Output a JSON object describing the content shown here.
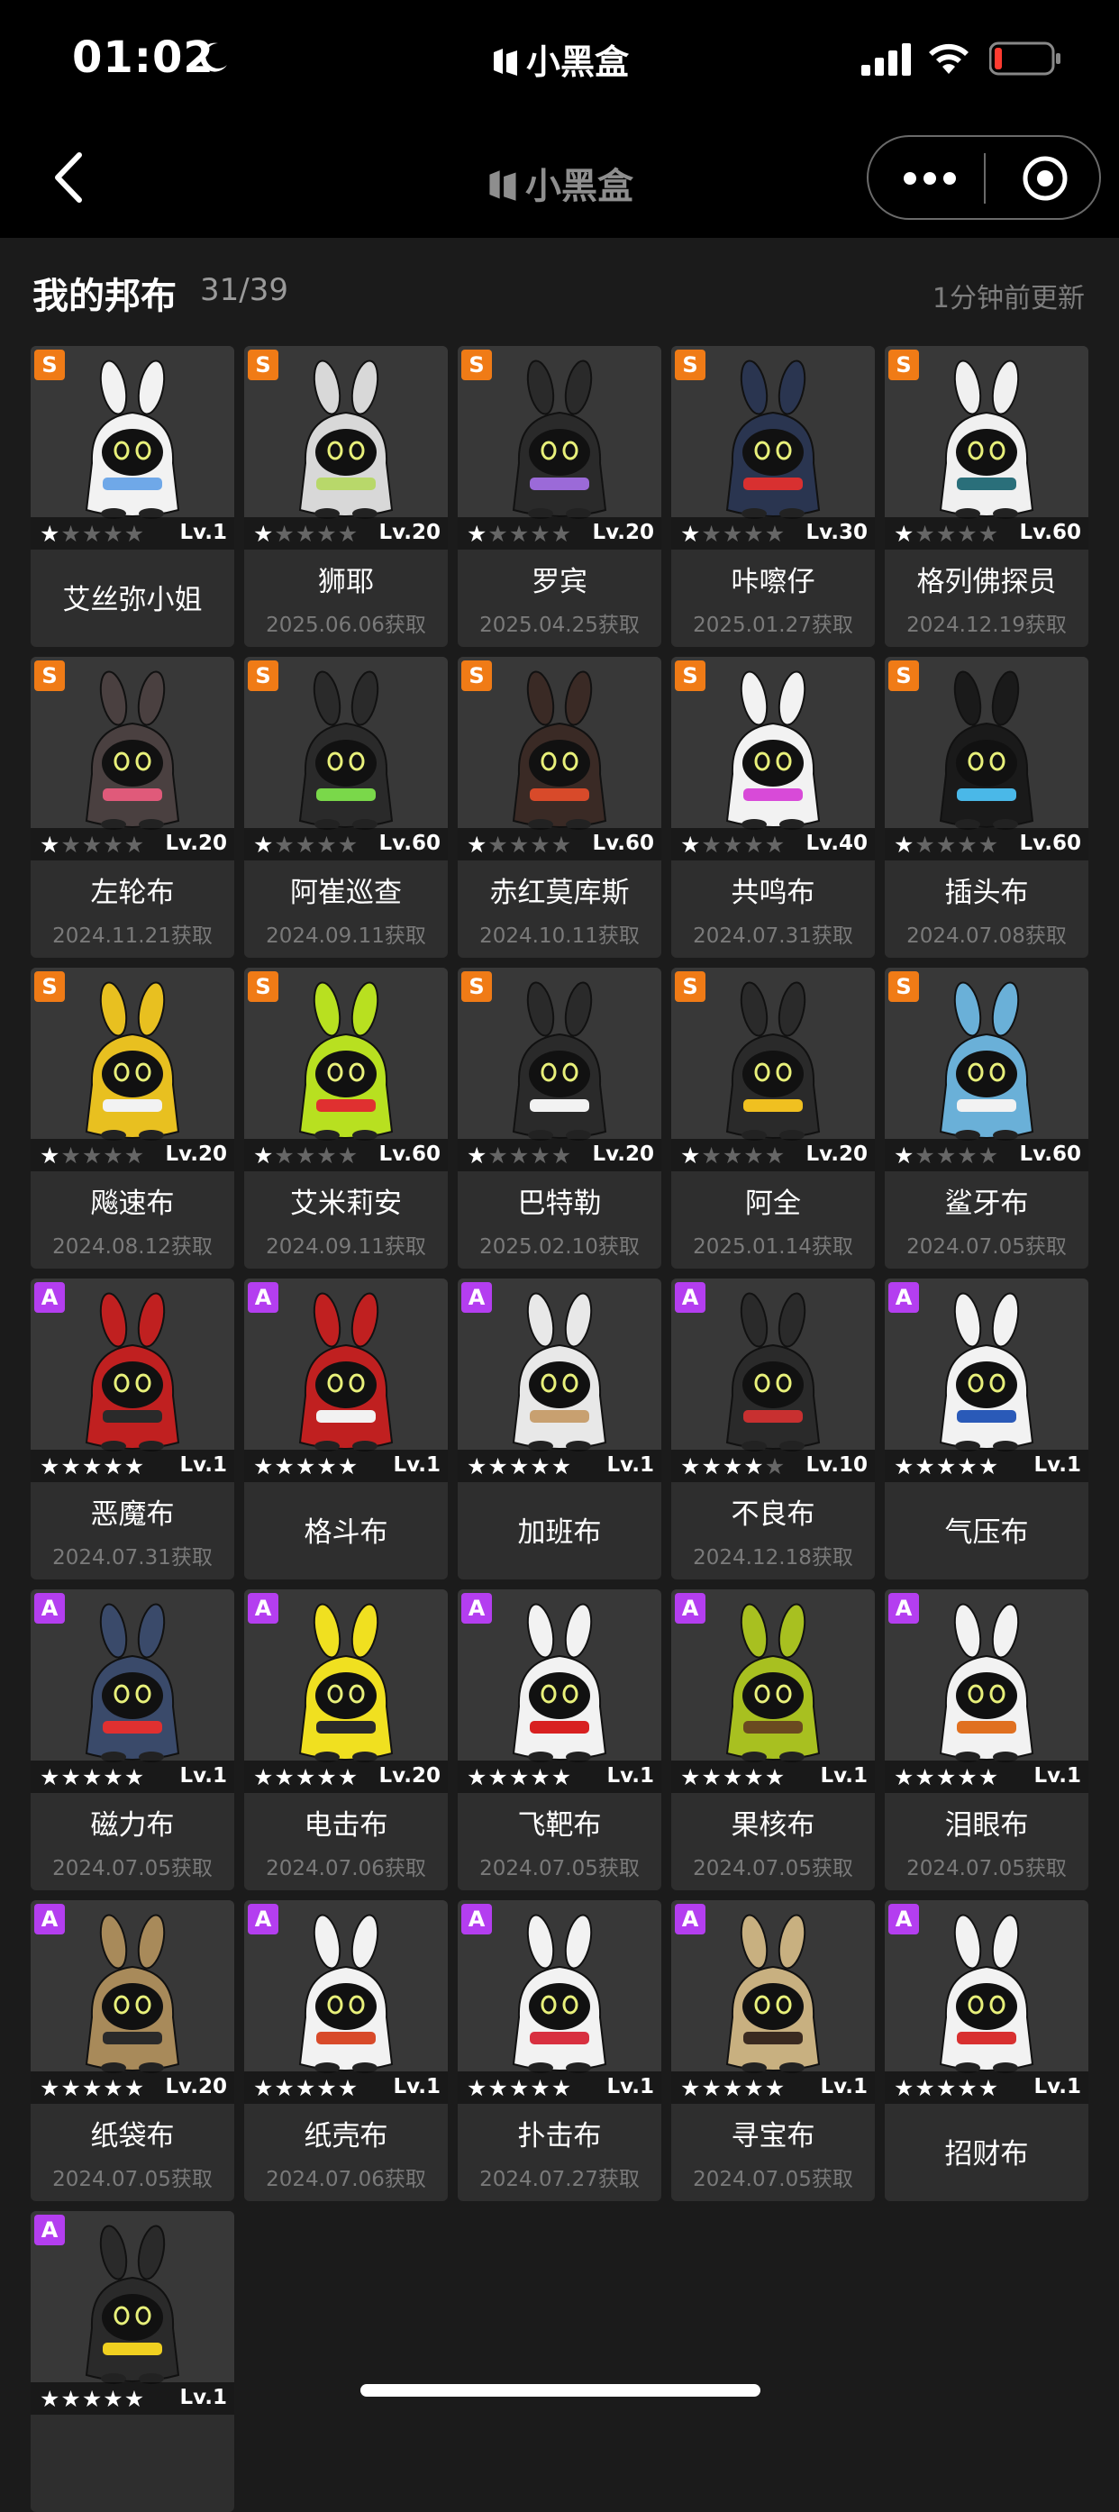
{
  "status_bar": {
    "time": "01:02",
    "app_name": "小黑盒"
  },
  "nav": {
    "title": "小黑盒"
  },
  "header": {
    "title": "我的邦布",
    "count": "31/39",
    "updated": "1分钟前更新"
  },
  "colors": {
    "rank_S": "#f07b16",
    "rank_A": "#b43ef0",
    "background": "#1b1b1b",
    "card": "#2e2e2e"
  },
  "bangboo": [
    {
      "rank": "S",
      "stars": 1,
      "level": "Lv.1",
      "name": "艾丝弥小姐",
      "date": "",
      "body": "#f2f2f2",
      "accent": "#6fa8e8"
    },
    {
      "rank": "S",
      "stars": 1,
      "level": "Lv.20",
      "name": "狮耶",
      "date": "2025.06.06获取",
      "body": "#d8d8d8",
      "accent": "#b8d86a"
    },
    {
      "rank": "S",
      "stars": 1,
      "level": "Lv.20",
      "name": "罗宾",
      "date": "2025.04.25获取",
      "body": "#2a2a2a",
      "accent": "#9b6ad8"
    },
    {
      "rank": "S",
      "stars": 1,
      "level": "Lv.30",
      "name": "咔嚓仔",
      "date": "2025.01.27获取",
      "body": "#2a3550",
      "accent": "#d83030"
    },
    {
      "rank": "S",
      "stars": 1,
      "level": "Lv.60",
      "name": "格列佛探员",
      "date": "2024.12.19获取",
      "body": "#f0f0f0",
      "accent": "#2a6f7a"
    },
    {
      "rank": "S",
      "stars": 1,
      "level": "Lv.20",
      "name": "左轮布",
      "date": "2024.11.21获取",
      "body": "#4a4040",
      "accent": "#e05a7a"
    },
    {
      "rank": "S",
      "stars": 1,
      "level": "Lv.60",
      "name": "阿崔巡查",
      "date": "2024.09.11获取",
      "body": "#2a2a2a",
      "accent": "#7ad84a"
    },
    {
      "rank": "S",
      "stars": 1,
      "level": "Lv.60",
      "name": "赤红莫库斯",
      "date": "2024.10.11获取",
      "body": "#3a2a25",
      "accent": "#d84a2a"
    },
    {
      "rank": "S",
      "stars": 1,
      "level": "Lv.40",
      "name": "共鸣布",
      "date": "2024.07.31获取",
      "body": "#f2f2f2",
      "accent": "#d84ad8"
    },
    {
      "rank": "S",
      "stars": 1,
      "level": "Lv.60",
      "name": "插头布",
      "date": "2024.07.08获取",
      "body": "#1a1a1a",
      "accent": "#4ab8e8"
    },
    {
      "rank": "S",
      "stars": 1,
      "level": "Lv.20",
      "name": "飚速布",
      "date": "2024.08.12获取",
      "body": "#e8c020",
      "accent": "#f2f2f2"
    },
    {
      "rank": "S",
      "stars": 1,
      "level": "Lv.60",
      "name": "艾米莉安",
      "date": "2024.09.11获取",
      "body": "#b8e020",
      "accent": "#e03030"
    },
    {
      "rank": "S",
      "stars": 1,
      "level": "Lv.20",
      "name": "巴特勒",
      "date": "2025.02.10获取",
      "body": "#2a2a2a",
      "accent": "#f2f2f2"
    },
    {
      "rank": "S",
      "stars": 1,
      "level": "Lv.20",
      "name": "阿全",
      "date": "2025.01.14获取",
      "body": "#2a2a2a",
      "accent": "#f0c020"
    },
    {
      "rank": "S",
      "stars": 1,
      "level": "Lv.60",
      "name": "鲨牙布",
      "date": "2024.07.05获取",
      "body": "#6ab0d8",
      "accent": "#f2f2f2"
    },
    {
      "rank": "A",
      "stars": 5,
      "level": "Lv.1",
      "name": "恶魔布",
      "date": "2024.07.31获取",
      "body": "#c02020",
      "accent": "#2a2a2a"
    },
    {
      "rank": "A",
      "stars": 5,
      "level": "Lv.1",
      "name": "格斗布",
      "date": "",
      "body": "#c02020",
      "accent": "#f2f2f2"
    },
    {
      "rank": "A",
      "stars": 5,
      "level": "Lv.1",
      "name": "加班布",
      "date": "",
      "body": "#e8e8e8",
      "accent": "#c8a070"
    },
    {
      "rank": "A",
      "stars": 4,
      "level": "Lv.10",
      "name": "不良布",
      "date": "2024.12.18获取",
      "body": "#2a2a2a",
      "accent": "#c83030"
    },
    {
      "rank": "A",
      "stars": 5,
      "level": "Lv.1",
      "name": "气压布",
      "date": "",
      "body": "#f2f2f2",
      "accent": "#2a5ab8"
    },
    {
      "rank": "A",
      "stars": 5,
      "level": "Lv.1",
      "name": "磁力布",
      "date": "2024.07.05获取",
      "body": "#3a4a6a",
      "accent": "#e03030"
    },
    {
      "rank": "A",
      "stars": 5,
      "level": "Lv.20",
      "name": "电击布",
      "date": "2024.07.06获取",
      "body": "#f0e020",
      "accent": "#2a2a2a"
    },
    {
      "rank": "A",
      "stars": 5,
      "level": "Lv.1",
      "name": "飞靶布",
      "date": "2024.07.05获取",
      "body": "#f2f2f2",
      "accent": "#d82020"
    },
    {
      "rank": "A",
      "stars": 5,
      "level": "Lv.1",
      "name": "果核布",
      "date": "2024.07.05获取",
      "body": "#a8c020",
      "accent": "#6a4a20"
    },
    {
      "rank": "A",
      "stars": 5,
      "level": "Lv.1",
      "name": "泪眼布",
      "date": "2024.07.05获取",
      "body": "#f2f2f2",
      "accent": "#e07020"
    },
    {
      "rank": "A",
      "stars": 5,
      "level": "Lv.20",
      "name": "纸袋布",
      "date": "2024.07.05获取",
      "body": "#a88a5a",
      "accent": "#2a2a2a"
    },
    {
      "rank": "A",
      "stars": 5,
      "level": "Lv.1",
      "name": "纸壳布",
      "date": "2024.07.06获取",
      "body": "#f2f2f2",
      "accent": "#d84a2a"
    },
    {
      "rank": "A",
      "stars": 5,
      "level": "Lv.1",
      "name": "扑击布",
      "date": "2024.07.27获取",
      "body": "#f2f2f2",
      "accent": "#d83040"
    },
    {
      "rank": "A",
      "stars": 5,
      "level": "Lv.1",
      "name": "寻宝布",
      "date": "2024.07.05获取",
      "body": "#c8b080",
      "accent": "#3a2a20"
    },
    {
      "rank": "A",
      "stars": 5,
      "level": "Lv.1",
      "name": "招财布",
      "date": "",
      "body": "#f2f2f2",
      "accent": "#d83030"
    },
    {
      "rank": "A",
      "stars": 5,
      "level": "Lv.1",
      "name": "",
      "date": "",
      "body": "#2a2a2a",
      "accent": "#f0d020"
    }
  ]
}
